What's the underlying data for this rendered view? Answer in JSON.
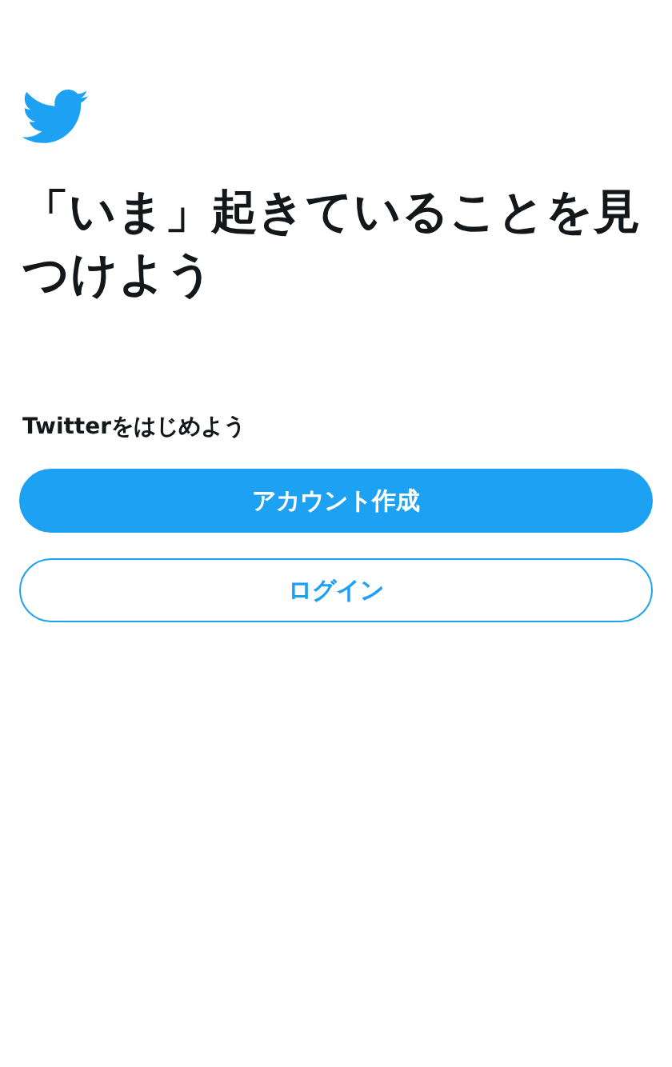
{
  "heading": "「いま」起きていることを見つけよう",
  "prompt": "Twitterをはじめよう",
  "buttons": [
    {
      "label": "アカウント作成",
      "kind": "primary"
    },
    {
      "label": "ログイン",
      "kind": "secondary"
    }
  ]
}
